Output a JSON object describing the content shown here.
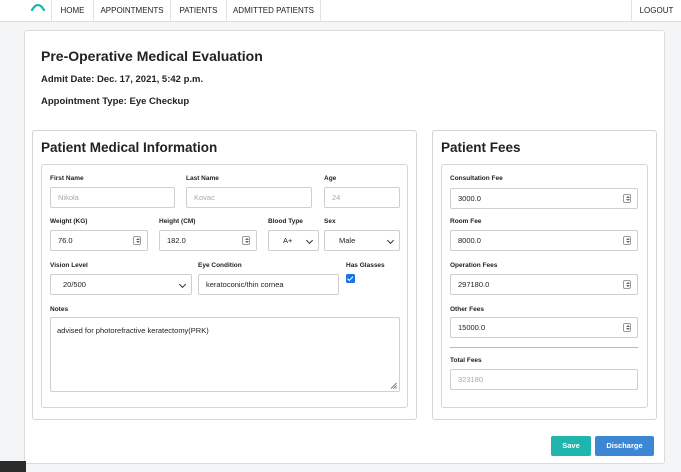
{
  "nav": {
    "items": [
      "HOME",
      "APPOINTMENTS",
      "PATIENTS",
      "ADMITTED PATIENTS"
    ],
    "logout": "LOGOUT"
  },
  "header": {
    "title": "Pre-Operative Medical Evaluation",
    "admit_date": "Admit Date: Dec. 17, 2021, 5:42 p.m.",
    "appointment_type": "Appointment Type: Eye Checkup"
  },
  "medical": {
    "title": "Patient Medical Information",
    "first_name_label": "First Name",
    "first_name": "Nikola",
    "last_name_label": "Last Name",
    "last_name": "Kovac",
    "age_label": "Age",
    "age": "24",
    "weight_label": "Weight (KG)",
    "weight": "76.0",
    "height_label": "Height (CM)",
    "height": "182.0",
    "blood_type_label": "Blood Type",
    "blood_type": "A+",
    "sex_label": "Sex",
    "sex": "Male",
    "vision_level_label": "Vision Level",
    "vision_level": "20/500",
    "eye_condition_label": "Eye Condition",
    "eye_condition": "keratoconic/thin cornea",
    "has_glasses_label": "Has Glasses",
    "has_glasses": true,
    "notes_label": "Notes",
    "notes": "advised for photorefractive keratectomy(PRK)"
  },
  "fees": {
    "title": "Patient Fees",
    "consultation_label": "Consultation Fee",
    "consultation": "3000.0",
    "room_label": "Room Fee",
    "room": "8000.0",
    "operation_label": "Operation Fees",
    "operation": "297180.0",
    "other_label": "Other Fees",
    "other": "15000.0",
    "total_label": "Total Fees",
    "total": "323180"
  },
  "actions": {
    "save": "Save",
    "discharge": "Discharge"
  },
  "colors": {
    "save": "#1fb5ac",
    "discharge": "#3c87d4",
    "checkbox": "#1a73e8"
  }
}
